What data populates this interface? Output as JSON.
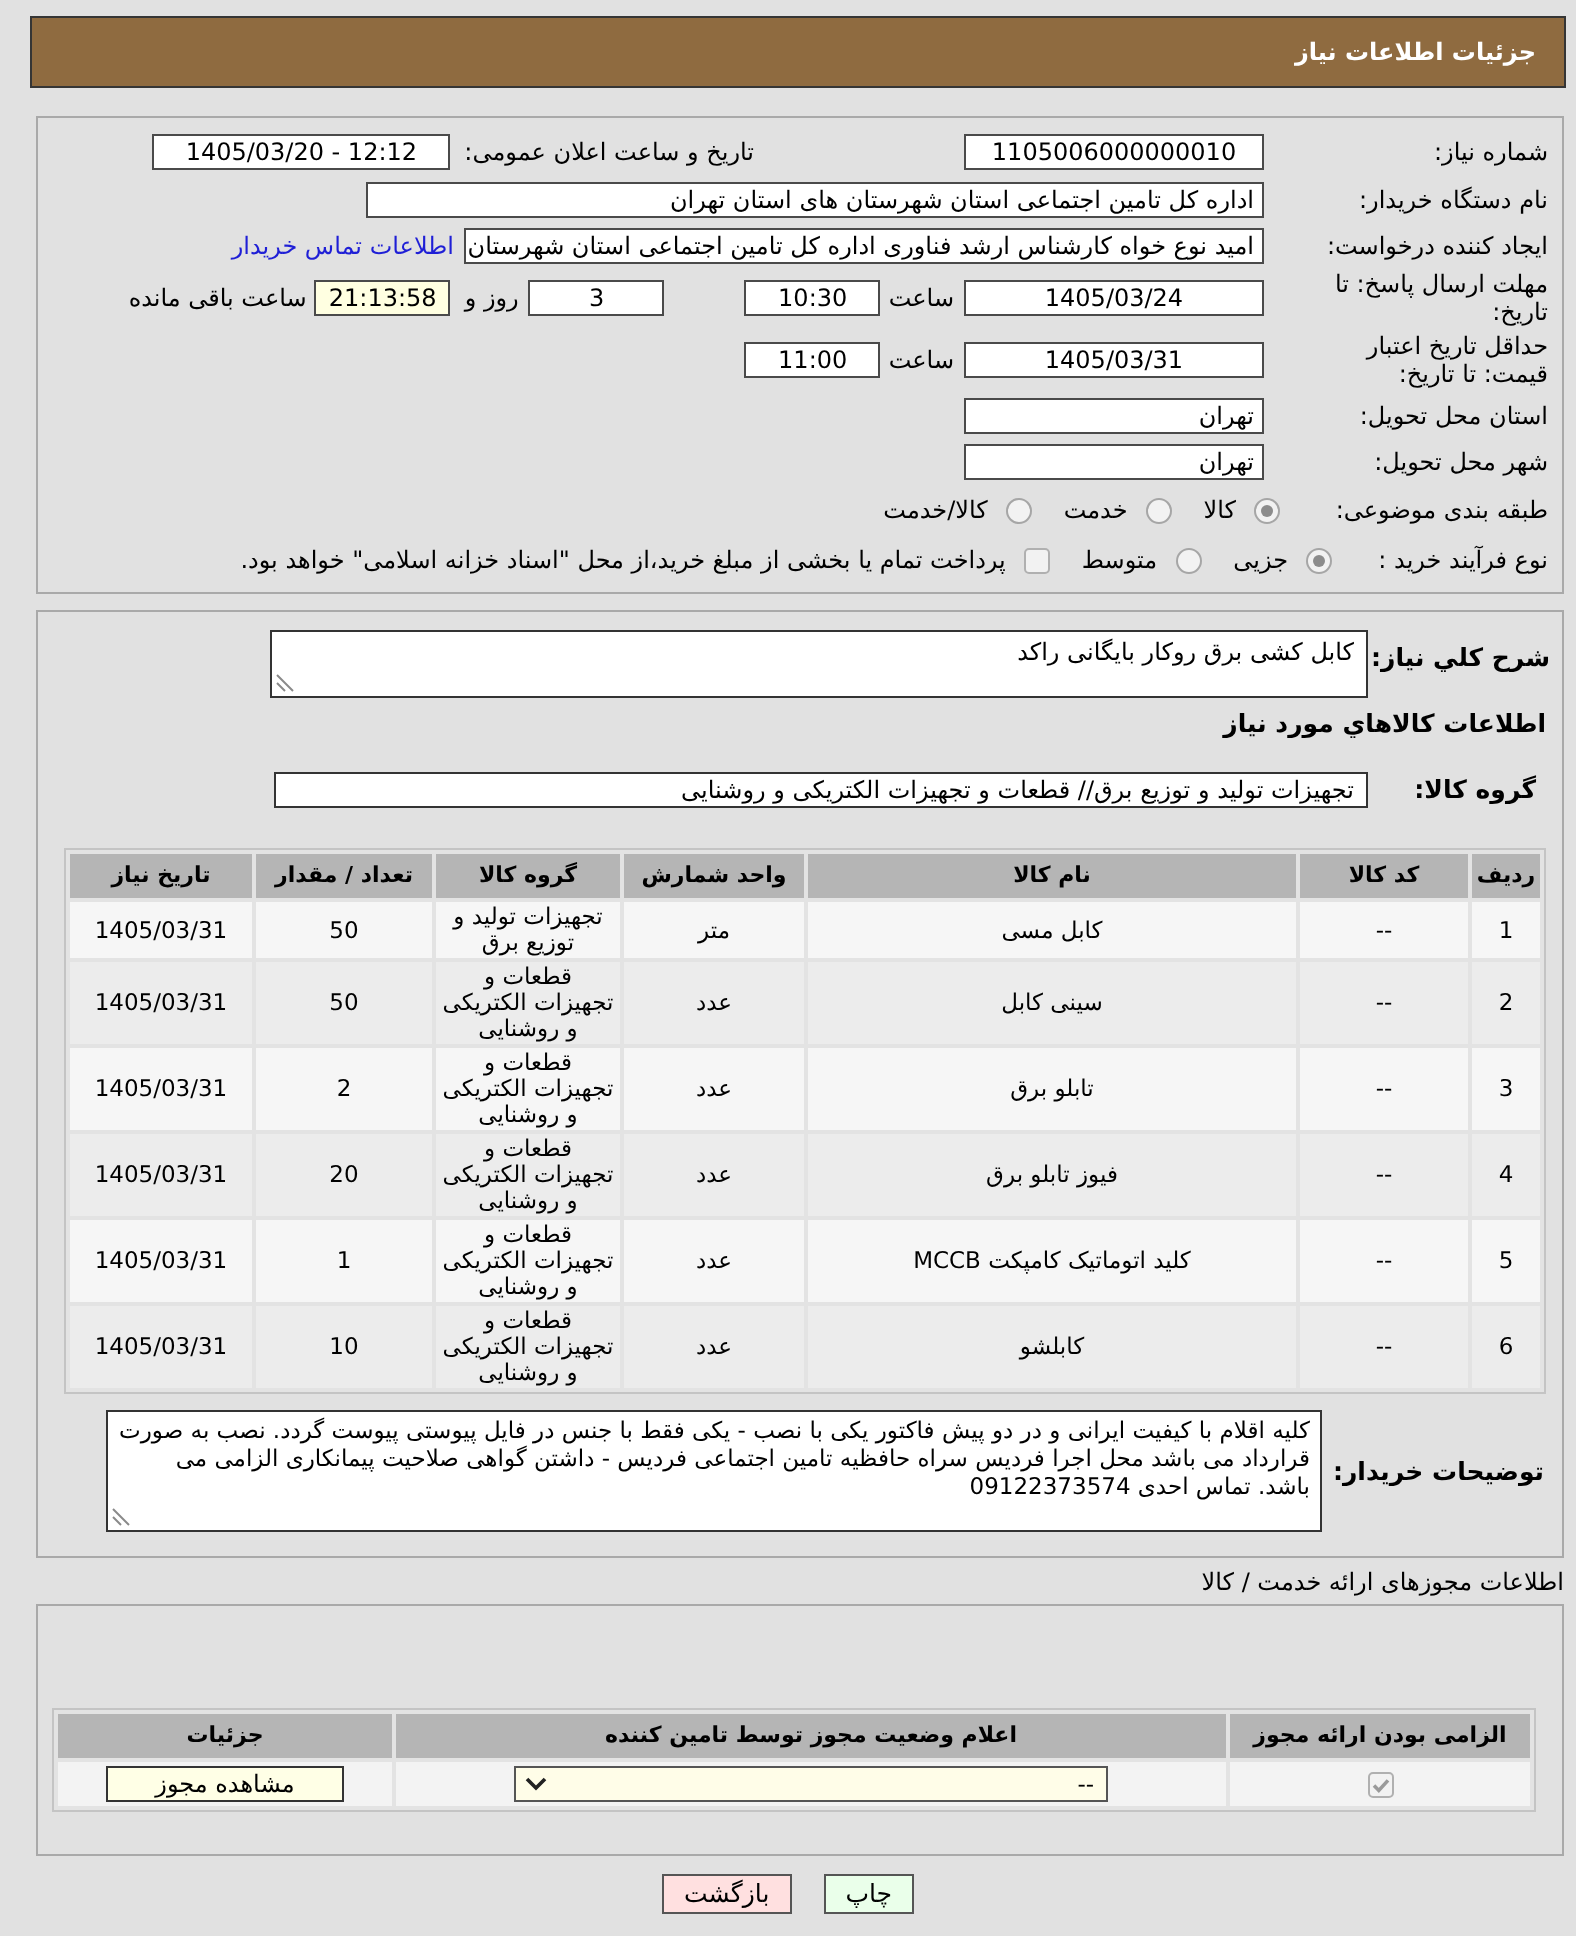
{
  "header": {
    "title": "جزئیات اطلاعات نیاز"
  },
  "need_details": {
    "need_number": {
      "label": "شماره نیاز:",
      "value": "1105006000000010"
    },
    "announcement": {
      "label": "تاریخ و ساعت اعلان عمومی:",
      "value": "1405/03/20 - 12:12"
    },
    "buyer_organization": {
      "label": "نام دستگاه خریدار:",
      "value": "اداره کل تامین اجتماعی استان شهرستان های استان تهران"
    },
    "requester": {
      "label": "ایجاد کننده درخواست:",
      "value": "امید نوع خواه کارشناس ارشد فناوری اداره کل تامین اجتماعی استان شهرستان",
      "contact_link": "اطلاعات تماس خریدار"
    },
    "response_deadline": {
      "label": "مهلت ارسال پاسخ: تا تاریخ:",
      "date": "1405/03/24",
      "time_label": "ساعت",
      "time": "10:30",
      "days": "3",
      "days_label": "روز و",
      "remaining": "21:13:58",
      "remaining_label": "ساعت باقی مانده"
    },
    "price_validity": {
      "label": "حداقل تاریخ اعتبار قیمت: تا تاریخ:",
      "date": "1405/03/31",
      "time_label": "ساعت",
      "time": "11:00"
    },
    "delivery_province": {
      "label": "استان محل تحویل:",
      "value": "تهران"
    },
    "delivery_city": {
      "label": "شهر محل تحویل:",
      "value": "تهران"
    },
    "subject_category": {
      "label": "طبقه بندی موضوعی:",
      "options": [
        {
          "label": "کالا",
          "selected": true
        },
        {
          "label": "خدمت",
          "selected": false
        },
        {
          "label": "کالا/خدمت",
          "selected": false
        }
      ]
    },
    "purchase_process": {
      "label": "نوع فرآیند خرید :",
      "options": [
        {
          "label": "جزیی",
          "selected": true
        },
        {
          "label": "متوسط",
          "selected": false
        }
      ],
      "treasury_payment": {
        "label": "پرداخت تمام یا بخشی از مبلغ خرید،از محل \"اسناد خزانه اسلامی\" خواهد بود.",
        "checked": false
      }
    }
  },
  "need_summary": {
    "label": "شرح كلي نياز:",
    "value": "کابل کشی برق روکار بایگانی راکد"
  },
  "goods": {
    "heading": "اطلاعات كالاهاي مورد نياز",
    "group_label": "گروه کالا:",
    "group_value": "تجهیزات تولید و توزیع برق// قطعات و تجهیزات الکتریکی و روشنایی",
    "table": {
      "columns": [
        "ردیف",
        "کد کالا",
        "نام کالا",
        "واحد شمارش",
        "گروه کالا",
        "تعداد / مقدار",
        "تاریخ نیاز"
      ],
      "rows": [
        [
          "1",
          "--",
          "کابل مسی",
          "متر",
          "تجهیزات تولید و توزیع برق",
          "50",
          "1405/03/31"
        ],
        [
          "2",
          "--",
          "سینی کابل",
          "عدد",
          "قطعات و تجهیزات الکتریکی و روشنایی",
          "50",
          "1405/03/31"
        ],
        [
          "3",
          "--",
          "تابلو برق",
          "عدد",
          "قطعات و تجهیزات الکتریکی و روشنایی",
          "2",
          "1405/03/31"
        ],
        [
          "4",
          "--",
          "فیوز تابلو برق",
          "عدد",
          "قطعات و تجهیزات الکتریکی و روشنایی",
          "20",
          "1405/03/31"
        ],
        [
          "5",
          "--",
          "کلید اتوماتیک کامپکت MCCB",
          "عدد",
          "قطعات و تجهیزات الکتریکی و روشنایی",
          "1",
          "1405/03/31"
        ],
        [
          "6",
          "--",
          "کابلشو",
          "عدد",
          "قطعات و تجهیزات الکتریکی و روشنایی",
          "10",
          "1405/03/31"
        ]
      ]
    }
  },
  "buyer_notes": {
    "label": "توضیحات خریدار:",
    "value": "کلیه اقلام با کیفیت ایرانی  و در دو پیش فاکتور یکی با نصب - یکی فقط با جنس در فایل پیوستی پیوست گردد.  نصب به صورت قرارداد می باشد محل اجرا فردیس سراه حافظیه تامین اجتماعی فردیس - داشتن گواهی صلاحیت پیمانکاری الزامی می باشد. تماس احدی 09122373574"
  },
  "licenses": {
    "heading": "اطلاعات مجوزهای ارائه خدمت / کالا",
    "table": {
      "columns": [
        "الزامی بودن ارائه مجوز",
        "اعلام وضعیت مجوز توسط تامین کننده",
        "جزئیات"
      ],
      "rows": [
        {
          "required": true,
          "status": "--",
          "details_button": "مشاهده مجوز"
        }
      ]
    }
  },
  "buttons": [
    {
      "kind": "print",
      "label": "چاپ"
    },
    {
      "kind": "back",
      "label": "بازگشت"
    }
  ]
}
